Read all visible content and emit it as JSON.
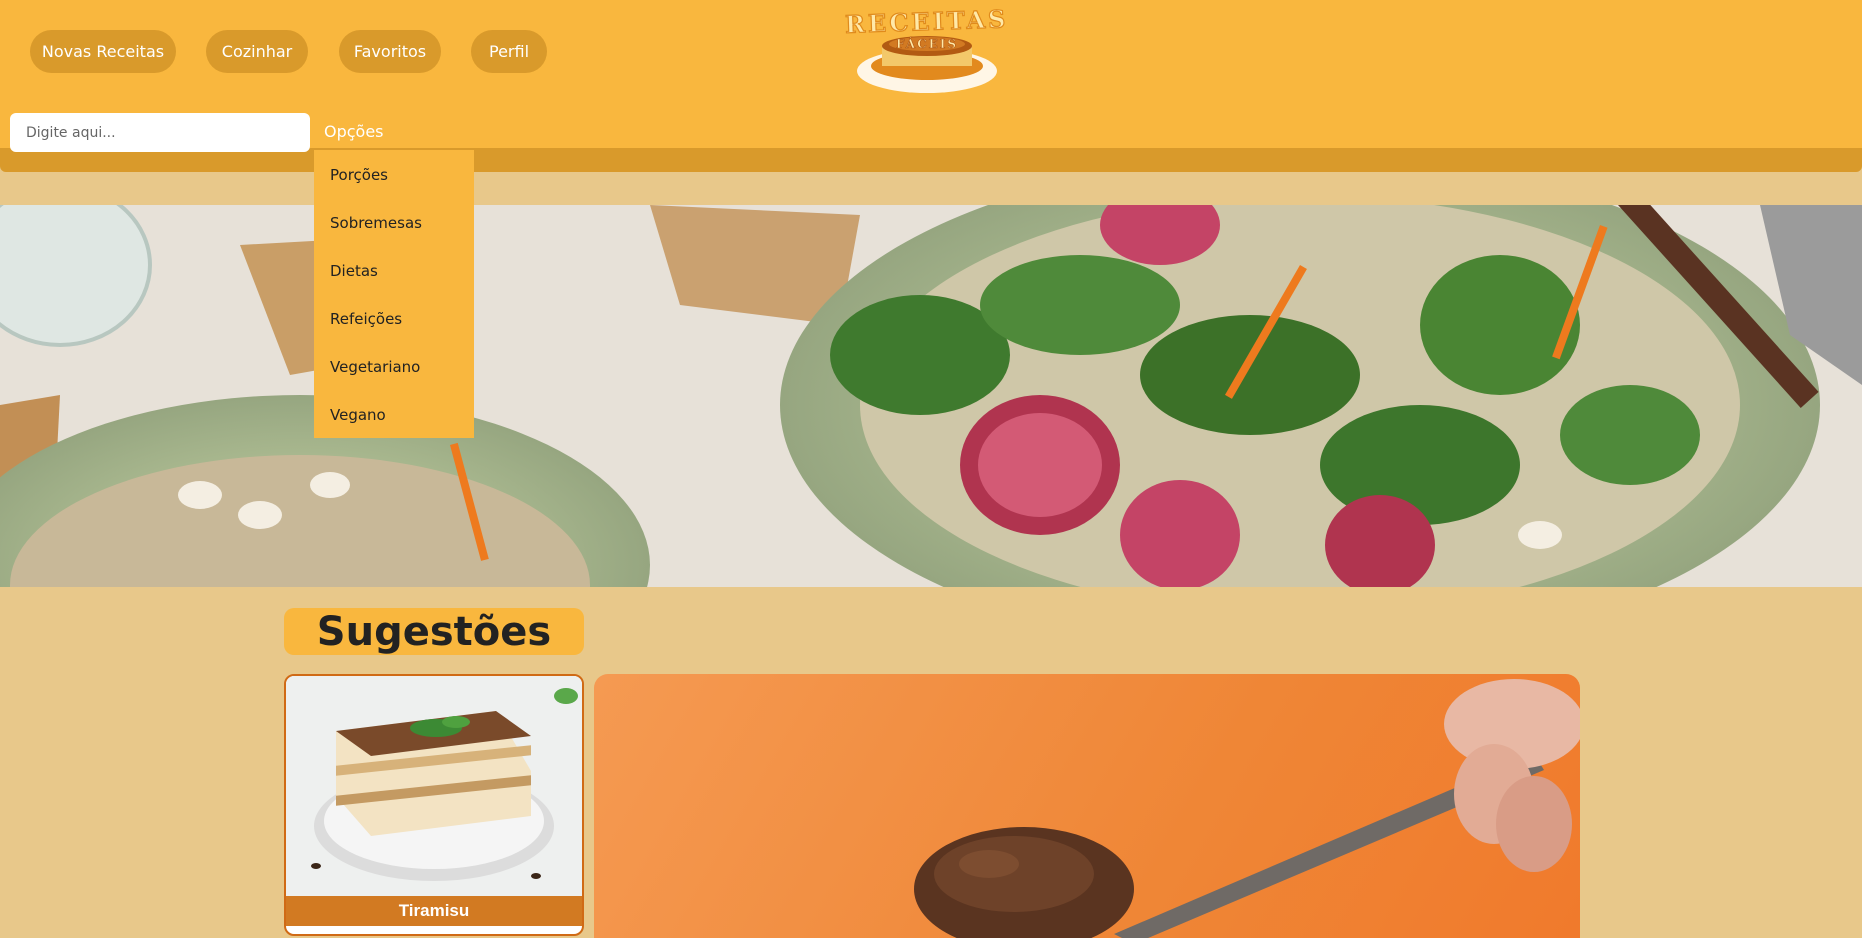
{
  "nav": {
    "items": [
      {
        "label": "Novas Receitas"
      },
      {
        "label": "Cozinhar"
      },
      {
        "label": "Favoritos"
      },
      {
        "label": "Perfil"
      }
    ]
  },
  "logo": {
    "title": "RECEITAS",
    "subtitle": "FÁCEIS"
  },
  "search": {
    "placeholder": "Digite aqui..."
  },
  "options": {
    "label": "Opções",
    "items": [
      "Porções",
      "Sobremesas",
      "Dietas",
      "Refeições",
      "Vegetariano",
      "Vegano"
    ]
  },
  "suggestions": {
    "title": "Sugestões",
    "cards": [
      {
        "label": "Tiramisu"
      }
    ]
  },
  "colors": {
    "header": "#f9b73e",
    "nav_button": "#d99a2b",
    "page_background": "#e8c88a",
    "card_border": "#d06a15",
    "feature_background": "#ef8636"
  }
}
